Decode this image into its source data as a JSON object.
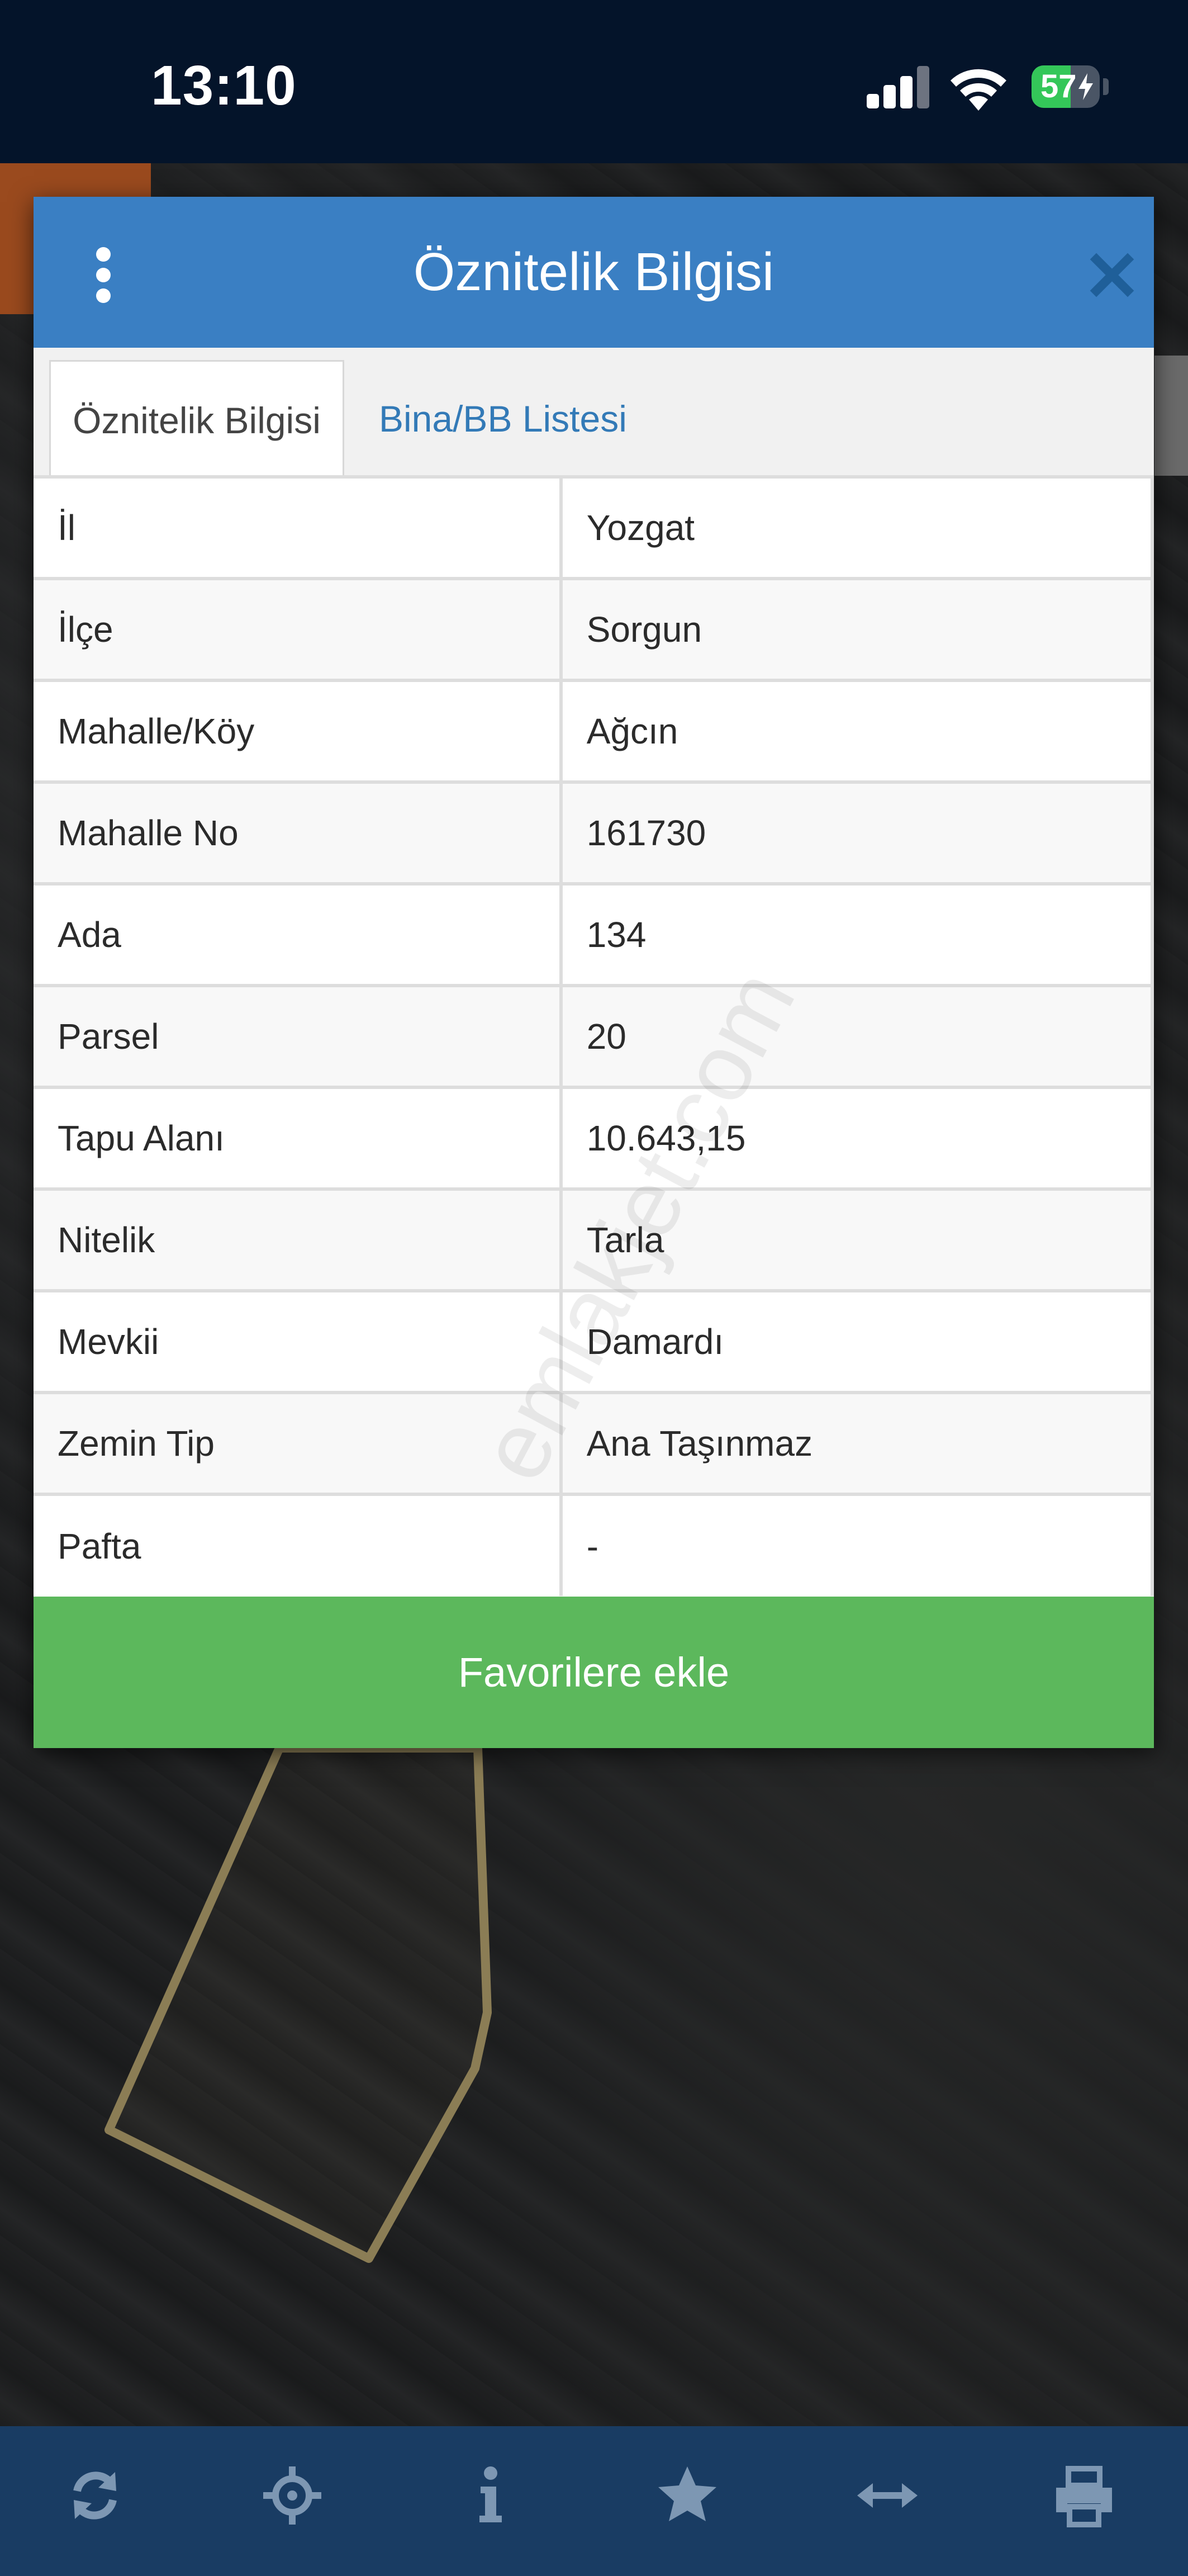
{
  "status_bar": {
    "time": "13:10",
    "battery_level": "57"
  },
  "modal": {
    "title": "Öznitelik Bilgisi",
    "tabs": [
      {
        "label": "Öznitelik Bilgisi",
        "active": true
      },
      {
        "label": "Bina/BB Listesi",
        "active": false
      }
    ],
    "attributes": [
      {
        "key": "İl",
        "value": "Yozgat"
      },
      {
        "key": "İlçe",
        "value": "Sorgun"
      },
      {
        "key": "Mahalle/Köy",
        "value": "Ağcın"
      },
      {
        "key": "Mahalle No",
        "value": "161730"
      },
      {
        "key": "Ada",
        "value": "134"
      },
      {
        "key": "Parsel",
        "value": "20"
      },
      {
        "key": "Tapu Alanı",
        "value": "10.643,15"
      },
      {
        "key": "Nitelik",
        "value": "Tarla"
      },
      {
        "key": "Mevkii",
        "value": "Damardı"
      },
      {
        "key": "Zemin Tip",
        "value": "Ana Taşınmaz"
      },
      {
        "key": "Pafta",
        "value": "-"
      }
    ],
    "favorite_button": "Favorilere ekle",
    "watermark": "emlakjet.com"
  },
  "toolbar": {
    "icons": [
      "refresh-icon",
      "locate-icon",
      "info-icon",
      "star-icon",
      "measure-icon",
      "print-icon"
    ]
  },
  "colors": {
    "header_blue": "#3a7fc3",
    "tab_link": "#337ab7",
    "favorite_green": "#5cb85c",
    "toolbar_bg": "#193c63",
    "toolbar_icon": "#7d97b3",
    "parcel_outline": "#8b7d55"
  }
}
